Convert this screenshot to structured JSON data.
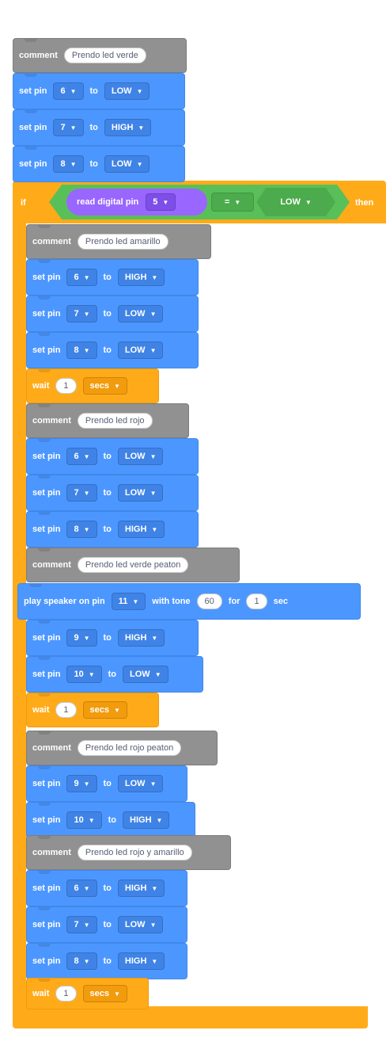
{
  "colors": {
    "comment": "#919191",
    "motion_blue": "#4c97ff",
    "control_orange": "#ffab19",
    "operator_green": "#59c059",
    "sensing_purple": "#9966ff"
  },
  "labels": {
    "comment": "comment",
    "set_pin": "set pin",
    "to": "to",
    "wait": "wait",
    "secs": "secs",
    "if": "if",
    "then": "then",
    "read_digital_pin": "read digital pin",
    "play_speaker": "play speaker on pin",
    "with_tone": "with tone",
    "for": "for",
    "sec": "sec"
  },
  "blocks": [
    {
      "type": "comment",
      "text": "Prendo led verde"
    },
    {
      "type": "set",
      "pin": "6",
      "value": "LOW"
    },
    {
      "type": "set",
      "pin": "7",
      "value": "HIGH"
    },
    {
      "type": "set",
      "pin": "8",
      "value": "LOW"
    },
    {
      "type": "if",
      "condition": {
        "pin": "5",
        "operator": "=",
        "value": "LOW"
      }
    },
    {
      "type": "comment",
      "text": "Prendo led amarillo"
    },
    {
      "type": "set",
      "pin": "6",
      "value": "HIGH"
    },
    {
      "type": "set",
      "pin": "7",
      "value": "LOW"
    },
    {
      "type": "set",
      "pin": "8",
      "value": "LOW"
    },
    {
      "type": "wait",
      "amount": "1"
    },
    {
      "type": "comment",
      "text": "Prendo led rojo"
    },
    {
      "type": "set",
      "pin": "6",
      "value": "LOW"
    },
    {
      "type": "set",
      "pin": "7",
      "value": "LOW"
    },
    {
      "type": "set",
      "pin": "8",
      "value": "HIGH"
    },
    {
      "type": "comment",
      "text": "Prendo led verde peaton"
    },
    {
      "type": "speaker",
      "pin": "11",
      "tone": "60",
      "duration": "1"
    },
    {
      "type": "set",
      "pin": "9",
      "value": "HIGH"
    },
    {
      "type": "set",
      "pin": "10",
      "value": "LOW"
    },
    {
      "type": "wait",
      "amount": "1"
    },
    {
      "type": "comment",
      "text": "Prendo led rojo peaton"
    },
    {
      "type": "set",
      "pin": "9",
      "value": "LOW"
    },
    {
      "type": "set",
      "pin": "10",
      "value": "HIGH"
    },
    {
      "type": "comment",
      "text": "Prendo led rojo y amarillo"
    },
    {
      "type": "set",
      "pin": "6",
      "value": "HIGH"
    },
    {
      "type": "set",
      "pin": "7",
      "value": "LOW"
    },
    {
      "type": "set",
      "pin": "8",
      "value": "HIGH"
    },
    {
      "type": "wait",
      "amount": "1"
    }
  ]
}
